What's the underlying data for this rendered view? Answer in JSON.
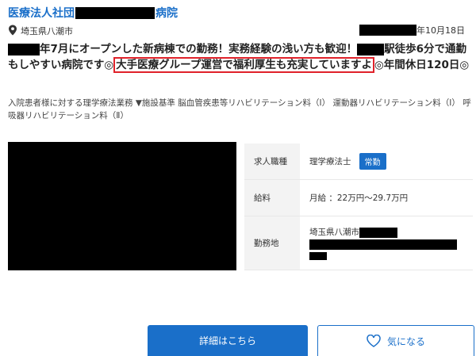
{
  "header": {
    "name_prefix": "医療法人社団",
    "name_suffix": "病院"
  },
  "location": {
    "icon": "map-pin-icon",
    "text": "埼玉県八潮市",
    "date_suffix": "年10月18日"
  },
  "headline": {
    "part1": "年7月にオープンした新病棟での勤務！実務経験の浅い方も歓迎！",
    "part2": "駅徒歩6分で通勤もしやすい病院です◎",
    "highlighted": "大手医療グループ運営で福利厚生も充実していますよ",
    "part3": "◎年間休日120日◎"
  },
  "description": "入院患者様に対する理学療法業務 ▼施設基準 脳血管疾患等リハビリテーション料（I） 運動器リハビリテーション料（I） 呼吸器リハビリテーション料（Ⅱ）",
  "info": {
    "job_label": "求人職種",
    "job_value": "理学療法士",
    "job_badge": "常勤",
    "salary_label": "給料",
    "salary_value": "月給 ：22万円〜29.7万円",
    "location_label": "勤務地",
    "location_value": "埼玉県八潮市"
  },
  "buttons": {
    "detail": "詳細はこちら",
    "favorite": "気になる",
    "favorite_icon": "heart-icon"
  },
  "colors": {
    "brand_blue": "#1a6fc9",
    "highlight_red": "#e0222a"
  }
}
